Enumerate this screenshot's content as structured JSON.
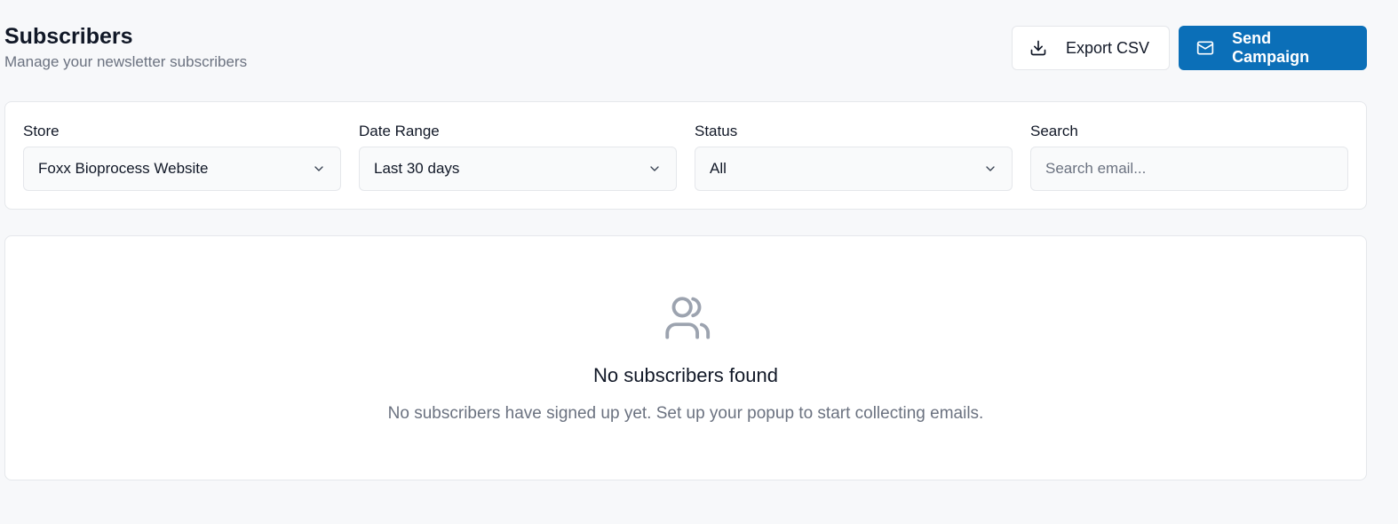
{
  "header": {
    "title": "Subscribers",
    "subtitle": "Manage your newsletter subscribers"
  },
  "actions": {
    "export_label": "Export CSV",
    "export_icon": "download-icon",
    "send_label": "Send Campaign",
    "send_icon": "mail-icon"
  },
  "filters": {
    "store": {
      "label": "Store",
      "value": "Foxx Bioprocess Website"
    },
    "date_range": {
      "label": "Date Range",
      "value": "Last 30 days"
    },
    "status": {
      "label": "Status",
      "value": "All"
    },
    "search": {
      "label": "Search",
      "value": "",
      "placeholder": "Search email..."
    }
  },
  "empty_state": {
    "icon": "users-icon",
    "title": "No subscribers found",
    "description": "No subscribers have signed up yet. Set up your popup to start collecting emails."
  },
  "colors": {
    "primary": "#0b6fb8",
    "background": "#f7f8fa",
    "muted_text": "#6b7280",
    "border": "#e5e7eb"
  }
}
